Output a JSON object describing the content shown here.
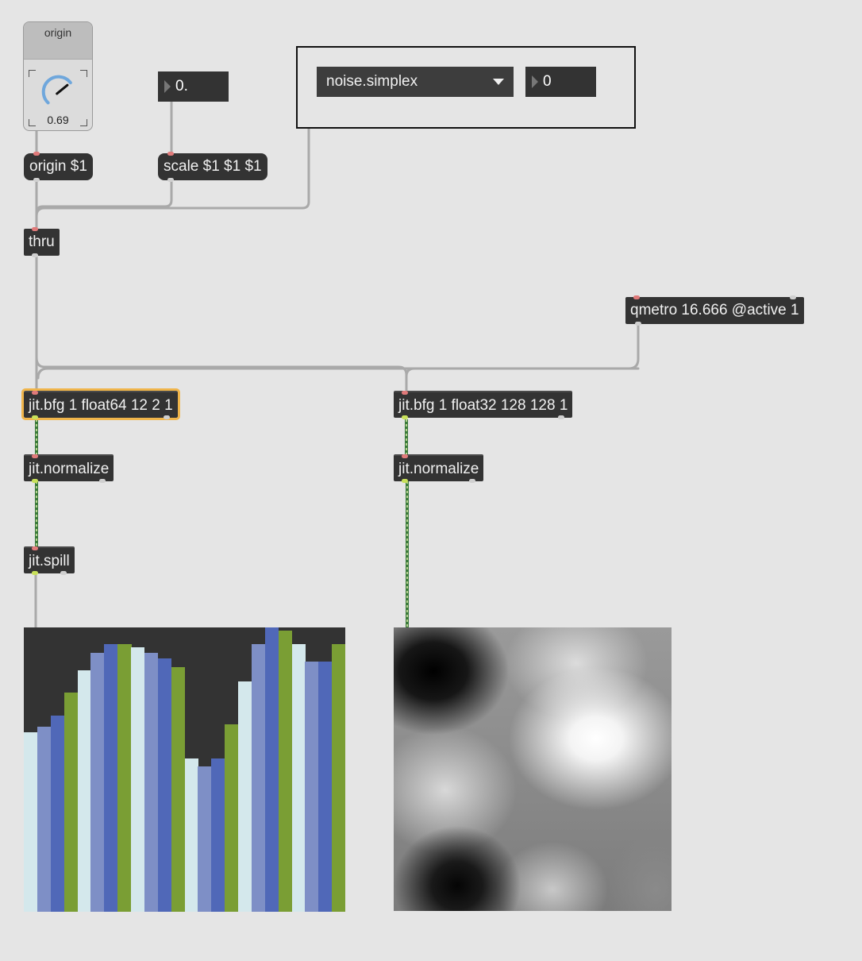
{
  "patcher": {
    "dial": {
      "label": "origin",
      "value": "0.69",
      "fraction": 0.69
    },
    "number_float": {
      "value": "0."
    },
    "umenu": {
      "selected": "noise.simplex"
    },
    "number_int": {
      "value": "0"
    },
    "messages": {
      "origin": "origin $1",
      "scale": "scale $1 $1 $1"
    },
    "objects": {
      "thru": "thru",
      "qmetro": "qmetro 16.666 @active 1",
      "bfg_left": "jit.bfg 1 float64 12 2 1",
      "bfg_right": "jit.bfg 1 float32 128 128 1",
      "normalize_left": "jit.normalize",
      "normalize_right": "jit.normalize",
      "spill": "jit.spill"
    },
    "multislider": {
      "bar_colors": [
        "#d4e8ec",
        "#7e8fc6",
        "#5068b8",
        "#7a9e34"
      ],
      "values": [
        0.63,
        0.65,
        0.69,
        0.77,
        0.85,
        0.91,
        0.94,
        0.94,
        0.93,
        0.91,
        0.89,
        0.86,
        0.54,
        0.51,
        0.54,
        0.66,
        0.81,
        0.94,
        1.0,
        0.99,
        0.94,
        0.88,
        0.88,
        0.94
      ]
    }
  }
}
